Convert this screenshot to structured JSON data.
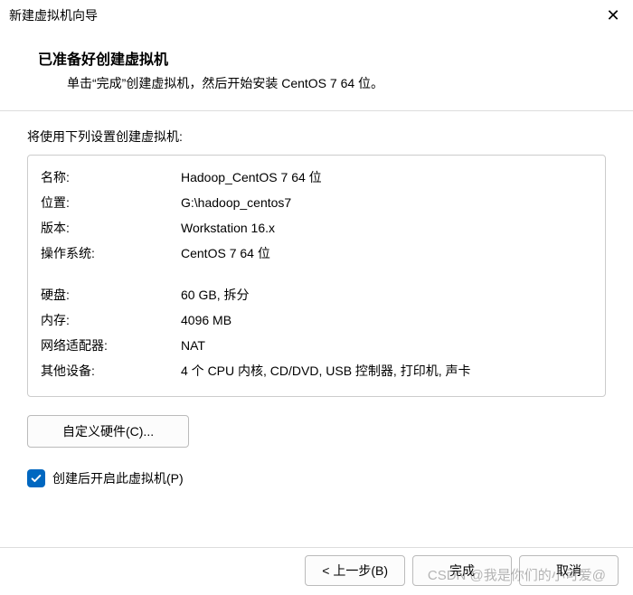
{
  "titlebar": {
    "title": "新建虚拟机向导"
  },
  "header": {
    "heading": "已准备好创建虚拟机",
    "sub": "单击“完成”创建虚拟机，然后开始安装 CentOS 7 64 位。"
  },
  "section_label": "将使用下列设置创建虚拟机:",
  "summary": {
    "name_label": "名称:",
    "name_value": "Hadoop_CentOS 7 64 位",
    "location_label": "位置:",
    "location_value": "G:\\hadoop_centos7",
    "version_label": "版本:",
    "version_value": "Workstation 16.x",
    "os_label": "操作系统:",
    "os_value": "CentOS 7 64 位",
    "disk_label": "硬盘:",
    "disk_value": "60 GB, 拆分",
    "memory_label": "内存:",
    "memory_value": "4096 MB",
    "network_label": "网络适配器:",
    "network_value": "NAT",
    "other_label": "其他设备:",
    "other_value": "4 个 CPU 内核, CD/DVD, USB 控制器, 打印机, 声卡"
  },
  "customize_label": "自定义硬件(C)...",
  "checkbox_label": "创建后开启此虚拟机(P)",
  "footer": {
    "back": "< 上一步(B)",
    "finish": "完成",
    "cancel": "取消"
  },
  "watermark": "CSDN @我是你们的小可爱@"
}
